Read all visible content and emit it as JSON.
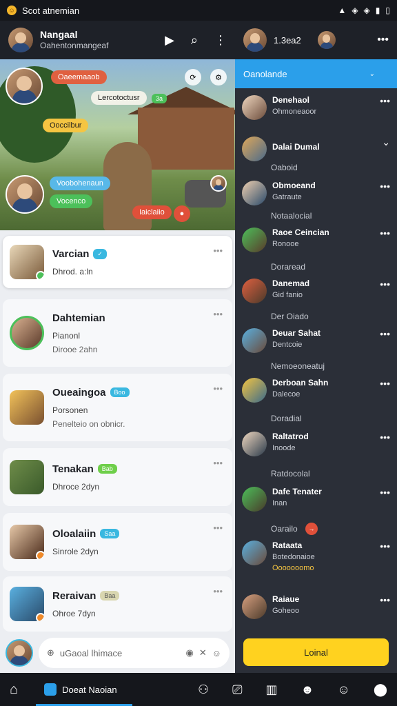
{
  "status_bar": {
    "title": "Scot atnemian"
  },
  "top_bar": {
    "title": "Nangaal",
    "subtitle": "Oahentonmangeaf",
    "icons": [
      "play-icon",
      "search-icon",
      "more-vertical-icon"
    ]
  },
  "right_top": {
    "label": "1.3ea2",
    "more": "•••"
  },
  "video": {
    "bubbles": [
      {
        "text": "Oaeemaaob",
        "color": "#e06040"
      },
      {
        "text": "Lercotoctusr",
        "color": "#f1f1e8"
      },
      {
        "text": "Ooccilbur",
        "color": "#f5c542"
      },
      {
        "text": "Voobohenaun",
        "color": "#58b8e8"
      },
      {
        "text": "Vocenco",
        "color": "#4cc05a"
      },
      {
        "text": "Iaiclaiio",
        "color": "#e0503a"
      }
    ],
    "pill_badge": "3a"
  },
  "chats": [
    {
      "name": "Varcian",
      "msg": "Dhrod. a:ln",
      "active": true
    },
    {
      "name": "Dahtemian",
      "msg": "Pianonl",
      "msg2": "Dirooe 2ahn"
    },
    {
      "name": "Oueaingoa",
      "tag": "Boo",
      "tag_color": "#3ab8e0",
      "msg": "Porsonen",
      "msg2": "Penelteio on obnicr."
    },
    {
      "name": "Tenakan",
      "tag": "Bab",
      "tag_color": "#6fcf4a",
      "msg": "Dhroce 2dyn"
    },
    {
      "name": "Oloalaiin",
      "tag": "Saa",
      "tag_color": "#3ab8e0",
      "msg": "Sinrole 2dyn"
    },
    {
      "name": "Reraivan",
      "tag": "Baa",
      "tag_color": "#d9d6b0",
      "msg": "Ohroe 7dyn"
    }
  ],
  "composer": {
    "placeholder": "uGaoal lhimace"
  },
  "right_panel": {
    "header": "Oanolande",
    "button": "Loinal",
    "items": [
      {
        "name": "Denehaol",
        "sub": "Ohmoneaoor"
      },
      {
        "sep": "Oaboid",
        "name": "Dalai Dumal",
        "sub": ""
      },
      {
        "name": "Obmoeand",
        "sub": "Gatraute"
      },
      {
        "sep": "Notaalocial",
        "name": "Raoe Ceincian",
        "sub": "Ronooe"
      },
      {
        "sep": "Doraread",
        "name": "Danemad",
        "sub": "Gid fanio"
      },
      {
        "sep": "Der Oiado",
        "name": "Deuar Sahat",
        "sub": "Dentcoie"
      },
      {
        "sep": "Nemoeoneatuj",
        "name": "Derboan Sahn",
        "sub": "Dalecoe"
      },
      {
        "sep": "Doradial",
        "name": "Raltatrod",
        "sub": "Inoode"
      },
      {
        "sep": "Ratdocolal",
        "name": "Dafe Tenater",
        "sub": "Inan"
      },
      {
        "sep": "Oarailo",
        "name": "Rataata",
        "sub": "Botedonaioe",
        "sub2": "Ooooooomo"
      },
      {
        "name": "Raiaue",
        "sub": "Goheoo"
      }
    ]
  },
  "bottom_nav": {
    "tab_label": "Doeat Naoian"
  }
}
